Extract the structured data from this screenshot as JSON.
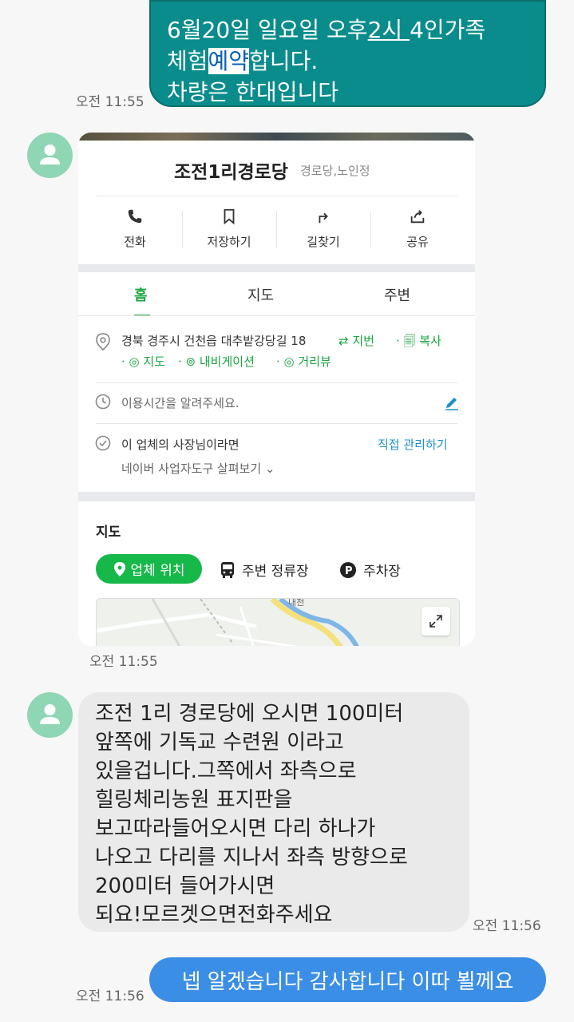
{
  "messages": {
    "top": {
      "line1_a": "6월20일 일요일 오후",
      "line1_b": "2시 ",
      "line1_c": "4인가족",
      "line2_a": "체험",
      "line2_b": "예약",
      "line2_c": "합니다.",
      "line3": "차량은 한대입니다",
      "time": "오전 11:55"
    },
    "card_time": "오전 11:55",
    "incoming": {
      "text": "조전 1리 경로당에 오시면 100미터\n앞쪽에  기독교 수련원 이라고\n있을겁니다.그쪽에서 좌측으로\n힐링체리농원 표지판을\n보고따라들어오시면 다리 하나가\n나오고 다리를 지나서 좌측 방향으로\n200미터 들어가시면\n되요!모르겟으면전화주세요",
      "time": "오전 11:56"
    },
    "bottom": {
      "text": "넵 알겠습니다 감사합니다 이따 뵐께요",
      "time": "오전 11:56"
    }
  },
  "card": {
    "title": "조전1리경로당",
    "category": "경로당,노인정",
    "actions": [
      "전화",
      "저장하기",
      "길찾기",
      "공유"
    ],
    "tabs": [
      "홈",
      "지도",
      "주변"
    ],
    "address": "경북 경주시 건천읍 대추밭강당길 18",
    "addr_links": [
      "지번",
      "복사"
    ],
    "addr_links2": [
      "지도",
      "내비게이션",
      "거리뷰"
    ],
    "hours_placeholder": "이용시간을 알려주세요.",
    "owner_text": "이 업체의 사장님이라면",
    "owner_link": "직접 관리하기",
    "owner_sub": "네이버 사업자도구 살펴보기",
    "map_title": "지도",
    "map_chips": [
      "업체 위치",
      "주변 정류장",
      "주차장"
    ],
    "map_label": "내천"
  },
  "colors": {
    "top_bubble": "#0a8c8c",
    "bottom_bubble": "#3b8ee6",
    "incoming_bubble": "#eaeaea",
    "accent_green": "#1aa642",
    "link_blue": "#1d8fc6"
  }
}
